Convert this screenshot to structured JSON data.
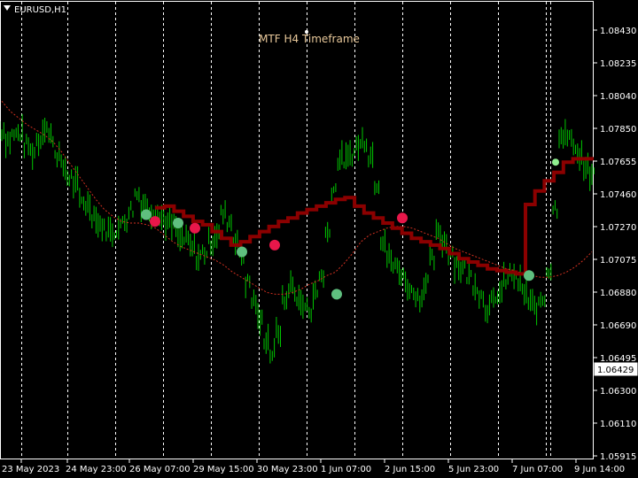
{
  "window": {
    "symbol_label": "EURUSD,H1"
  },
  "indicator": {
    "label": "MTF H4 Timeframe"
  },
  "price_badge": {
    "value": "1.06429"
  },
  "colors": {
    "background": "#000000",
    "price_bars": "#00c800",
    "dashed_ma": "#d03020",
    "step_line": "#8b0000",
    "dot_green": "#5fbf7f",
    "dot_red": "#e8174a",
    "dot_lightgreen": "#90ee90",
    "grid": "#ffffff",
    "label_text": "#e8c89a"
  },
  "chart_data": {
    "type": "line",
    "title": "EURUSD,H1",
    "annotation": "MTF H4 Timeframe",
    "y_ticks": [
      "1.08430",
      "1.08235",
      "1.08040",
      "1.07850",
      "1.07655",
      "1.07460",
      "1.07270",
      "1.07075",
      "1.06880",
      "1.06690",
      "1.06495",
      "1.06300",
      "1.06110",
      "1.05915"
    ],
    "ylim": [
      1.05915,
      1.0843
    ],
    "x_ticks": [
      "23 May 2023",
      "24 May 23:00",
      "26 May 07:00",
      "29 May 15:00",
      "30 May 23:00",
      "1 Jun 07:00",
      "2 Jun 15:00",
      "5 Jun 23:00",
      "7 Jun 07:00",
      "9 Jun 14:00"
    ],
    "grid": "vertical dashed",
    "series": [
      {
        "values": [
          1.0784,
          1.0778,
          1.0781,
          1.0782,
          1.0775,
          1.0771,
          1.0778,
          1.0786,
          1.078,
          1.077,
          1.0762,
          1.0756,
          1.0752,
          1.0742,
          1.074,
          1.0734,
          1.0728,
          1.0725,
          1.0724,
          1.0726,
          1.0731,
          1.0737,
          1.0746,
          1.074,
          1.0736,
          1.0738,
          1.0732,
          1.0729,
          1.0727,
          1.072,
          1.0719,
          1.0714,
          1.0709,
          1.0712,
          1.0718,
          1.0723,
          1.0734,
          1.073,
          1.072,
          1.0708,
          1.0694,
          1.0683,
          1.0671,
          1.0661,
          1.0652,
          1.0665,
          1.0683,
          1.0692,
          1.0686,
          1.068,
          1.0678,
          1.0687,
          1.0698,
          1.0723,
          1.0749,
          1.0767,
          1.0766,
          1.077,
          1.0775,
          1.0778,
          1.0769,
          1.0753,
          1.072,
          1.0708,
          1.0703,
          1.07,
          1.0692,
          1.0688,
          1.0685,
          1.0694,
          1.0707,
          1.0722,
          1.0718,
          1.0712,
          1.0705,
          1.0702,
          1.0698,
          1.0693,
          1.0686,
          1.0679,
          1.0682,
          1.0688,
          1.0695,
          1.0699,
          1.0694,
          1.0688,
          1.0681,
          1.0679,
          1.0684,
          1.0702,
          1.0738,
          1.0782,
          1.078,
          1.0776,
          1.0769,
          1.0761,
          1.0756
        ]
      },
      {
        "values": [
          1.0801,
          1.0795,
          1.0791,
          1.0787,
          1.0784,
          1.0781,
          1.0777,
          1.0771,
          1.0764,
          1.0757,
          1.075,
          1.0743,
          1.0737,
          1.0733,
          1.073,
          1.0729,
          1.0729,
          1.0728,
          1.0726,
          1.0722,
          1.0718,
          1.0715,
          1.0713,
          1.0711,
          1.0709,
          1.0707,
          1.0704,
          1.07,
          1.0697,
          1.0694,
          1.0691,
          1.0688,
          1.0687,
          1.0687,
          1.0688,
          1.069,
          1.0693,
          1.0695,
          1.0698,
          1.07,
          1.0705,
          1.0711,
          1.0718,
          1.0722,
          1.0724,
          1.0726,
          1.0727,
          1.0727,
          1.0726,
          1.0724,
          1.0722,
          1.072,
          1.0717,
          1.0714,
          1.0712,
          1.071,
          1.0708,
          1.0706,
          1.0704,
          1.0702,
          1.0701,
          1.0699,
          1.0698,
          1.0697,
          1.0697,
          1.0698,
          1.07,
          1.0703,
          1.0707,
          1.0712
        ]
      },
      {
        "values": [
          1.0738,
          1.0739,
          1.0736,
          1.0733,
          1.073,
          1.0728,
          1.0724,
          1.072,
          1.0716,
          1.0718,
          1.0721,
          1.0724,
          1.0727,
          1.073,
          1.0732,
          1.0735,
          1.0737,
          1.0739,
          1.0741,
          1.0743,
          1.0744,
          1.0739,
          1.0735,
          1.0732,
          1.0729,
          1.0726,
          1.0723,
          1.072,
          1.0718,
          1.0716,
          1.0714,
          1.0711,
          1.0708,
          1.0706,
          1.0704,
          1.0702,
          1.0701,
          1.07,
          1.0699,
          1.074,
          1.0748,
          1.0754,
          1.0759,
          1.0765,
          1.0767,
          1.0767,
          1.0766
        ]
      }
    ],
    "markers": [
      {
        "x": "26 May 07:00",
        "y": 1.0734,
        "color": "green"
      },
      {
        "x": "26 May 07:00",
        "y": 1.073,
        "color": "red"
      },
      {
        "x": "29 May 15:00",
        "y": 1.0729,
        "color": "green"
      },
      {
        "x": "29 May 15:00",
        "y": 1.0726,
        "color": "red"
      },
      {
        "x": "30 May 23:00",
        "y": 1.0712,
        "color": "green"
      },
      {
        "x": "30 May 23:00",
        "y": 1.0716,
        "color": "red"
      },
      {
        "x": "1 Jun 07:00",
        "y": 1.0687,
        "color": "green"
      },
      {
        "x": "2 Jun 15:00",
        "y": 1.0732,
        "color": "red"
      },
      {
        "x": "7 Jun 07:00",
        "y": 1.0698,
        "color": "green"
      },
      {
        "x": "9 Jun 14:00",
        "y": 1.0765,
        "color": "lightgreen"
      }
    ]
  }
}
